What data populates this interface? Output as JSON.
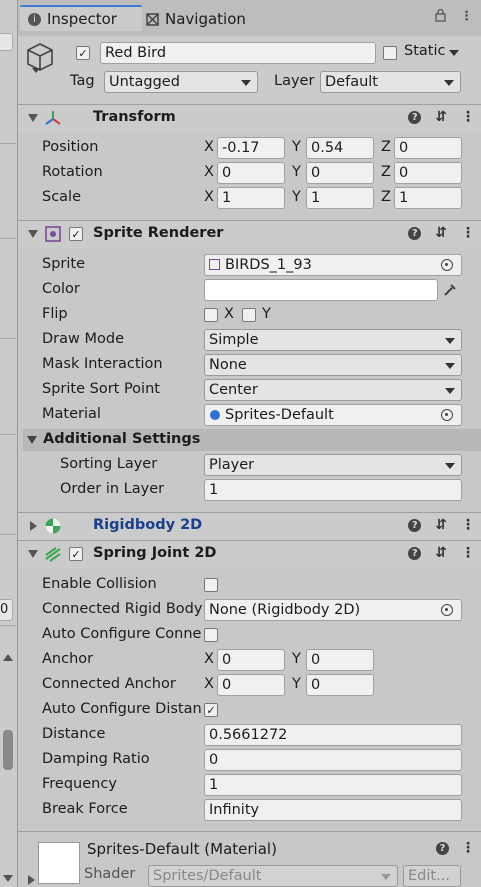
{
  "tabs": {
    "inspector": "Inspector",
    "navigation": "Navigation"
  },
  "object": {
    "name": "Red Bird",
    "static_label": "Static",
    "tag_label": "Tag",
    "tag_value": "Untagged",
    "layer_label": "Layer",
    "layer_value": "Default"
  },
  "transform": {
    "title": "Transform",
    "position_label": "Position",
    "rotation_label": "Rotation",
    "scale_label": "Scale",
    "x": "X",
    "y": "Y",
    "z": "Z",
    "position": {
      "x": "-0.17",
      "y": "0.54",
      "z": "0"
    },
    "rotation": {
      "x": "0",
      "y": "0",
      "z": "0"
    },
    "scale": {
      "x": "1",
      "y": "1",
      "z": "1"
    }
  },
  "sprite_renderer": {
    "title": "Sprite Renderer",
    "sprite_label": "Sprite",
    "sprite_value": "BIRDS_1_93",
    "color_label": "Color",
    "flip_label": "Flip",
    "flip_x": "X",
    "flip_y": "Y",
    "draw_mode_label": "Draw Mode",
    "draw_mode": "Simple",
    "mask_label": "Mask Interaction",
    "mask": "None",
    "sort_point_label": "Sprite Sort Point",
    "sort_point": "Center",
    "material_label": "Material",
    "material": "Sprites-Default",
    "additional": "Additional Settings",
    "sorting_layer_label": "Sorting Layer",
    "sorting_layer": "Player",
    "order_label": "Order in Layer",
    "order": "1"
  },
  "rigidbody": {
    "title": "Rigidbody 2D"
  },
  "spring": {
    "title": "Spring Joint 2D",
    "enable_collision": "Enable Collision",
    "connected_rb_label": "Connected Rigid Body",
    "connected_rb": "None (Rigidbody 2D)",
    "auto_conn": "Auto Configure Conne",
    "anchor": "Anchor",
    "anchor_x": "0",
    "anchor_y": "0",
    "conn_anchor": "Connected Anchor",
    "conn_anchor_x": "0",
    "conn_anchor_y": "0",
    "auto_dist": "Auto Configure Distan",
    "check_mark": "✓",
    "distance_label": "Distance",
    "distance": "0.5661272",
    "damping_label": "Damping Ratio",
    "damping": "0",
    "frequency_label": "Frequency",
    "frequency": "1",
    "break_label": "Break Force",
    "break_force": "Infinity"
  },
  "material_footer": {
    "title": "Sprites-Default (Material)",
    "shader_label": "Shader",
    "shader": "Sprites/Default",
    "edit": "Edit..."
  },
  "left_strip": {
    "value": "0"
  },
  "icons": {
    "lock": "lock-icon",
    "menu": "kebab-menu-icon",
    "help": "help-icon",
    "presets": "presets-icon"
  }
}
